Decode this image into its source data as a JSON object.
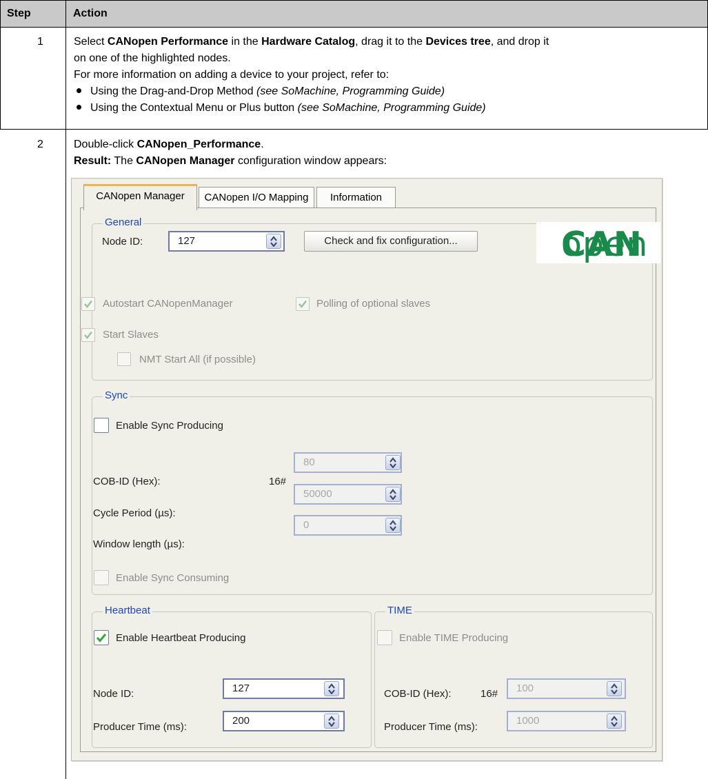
{
  "table": {
    "headers": {
      "step": "Step",
      "action": "Action"
    },
    "rows": [
      {
        "step": "1",
        "line1": {
          "t1": "Select ",
          "b1": "CANopen Performance",
          "t2": " in the ",
          "b2": "Hardware Catalog",
          "t3": ", drag it to the ",
          "b3": "Devices tree",
          "t4": ", and drop it"
        },
        "line2": "on one of the highlighted nodes.",
        "line3": "For more information on adding a device to your project, refer to:",
        "bullets": [
          {
            "text": "Using the Drag-and-Drop Method ",
            "ref": "(see SoMachine, Programming Guide)"
          },
          {
            "text": "Using the Contextual Menu or Plus button ",
            "ref": "(see SoMachine, Programming Guide)"
          }
        ]
      },
      {
        "step": "2",
        "line1": {
          "t1": "Double-click ",
          "b1": "CANopen_Performance",
          "t2": "."
        },
        "line2": {
          "b1": "Result:",
          "t1": " The ",
          "b2": "CANopen Manager",
          "t2": " configuration window appears:"
        }
      }
    ]
  },
  "dialog": {
    "tabs": [
      "CANopen Manager",
      "CANopen I/O Mapping",
      "Information"
    ],
    "active_tab": "CANopen Manager",
    "accent": "#f4b24a",
    "general": {
      "title": "General",
      "node_id_label": "Node ID:",
      "node_id_value": "127",
      "check_button": "Check and fix configuration...",
      "logo": {
        "bold": "CAN",
        "light": "open",
        "color": "#1a8a4a"
      },
      "autostart_label": "Autostart CANopenManager",
      "autostart_checked": true,
      "polling_label": "Polling of optional slaves",
      "polling_checked": true,
      "start_slaves_label": "Start Slaves",
      "start_slaves_checked": true,
      "nmt_label": "NMT Start All (if possible)",
      "nmt_checked": false
    },
    "sync": {
      "title": "Sync",
      "enable_producing_label": "Enable Sync Producing",
      "enable_producing_checked": false,
      "cob_id_label": "COB-ID (Hex):",
      "cob_id_prefix": "16#",
      "cob_id_value": "80",
      "cycle_label": "Cycle Period (µs):",
      "cycle_value": "50000",
      "window_label": "Window length (µs):",
      "window_value": "0",
      "enable_consuming_label": "Enable Sync Consuming",
      "enable_consuming_checked": false
    },
    "heartbeat": {
      "title": "Heartbeat",
      "enable_label": "Enable Heartbeat Producing",
      "enable_checked": true,
      "node_id_label": "Node ID:",
      "node_id_value": "127",
      "producer_label": "Producer Time (ms):",
      "producer_value": "200"
    },
    "time": {
      "title": "TIME",
      "enable_label": "Enable TIME Producing",
      "enable_checked": false,
      "cob_id_label": "COB-ID (Hex):",
      "cob_id_prefix": "16#",
      "cob_id_value": "100",
      "producer_label": "Producer Time (ms):",
      "producer_value": "1000"
    }
  }
}
